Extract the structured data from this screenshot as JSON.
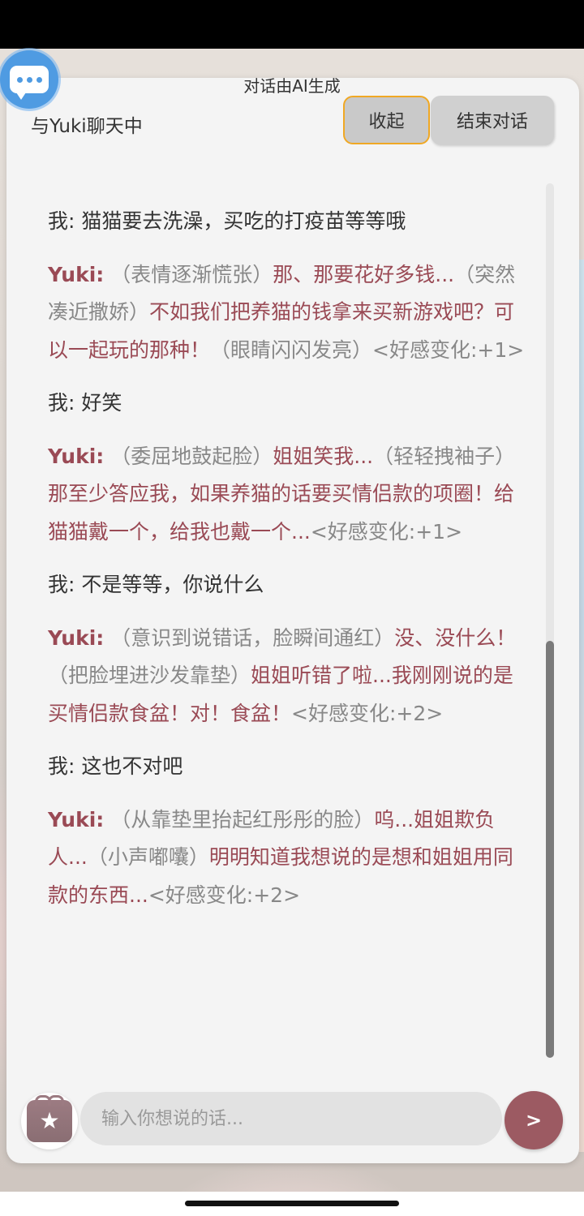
{
  "header": {
    "ai_disclaimer": "对话由AI生成",
    "chat_title": "与Yuki聊天中",
    "collapse_label": "收起",
    "end_label": "结束对话"
  },
  "conversation": [
    {
      "speaker": "我:",
      "segments": [
        {
          "type": "me-text",
          "text": "猫猫要去洗澡，买吃的打疫苗等等哦"
        }
      ]
    },
    {
      "speaker": "Yuki:",
      "segments": [
        {
          "type": "action",
          "text": "（表情逐渐慌张）"
        },
        {
          "type": "speech",
          "text": "那、那要花好多钱..."
        },
        {
          "type": "action",
          "text": "（突然凑近撒娇）"
        },
        {
          "type": "speech",
          "text": "不如我们把养猫的钱拿来买新游戏吧？可以一起玩的那种！"
        },
        {
          "type": "action",
          "text": "（眼睛闪闪发亮）"
        },
        {
          "type": "tag",
          "text": "<好感变化:+1>"
        }
      ]
    },
    {
      "speaker": "我:",
      "segments": [
        {
          "type": "me-text",
          "text": "好笑"
        }
      ]
    },
    {
      "speaker": "Yuki:",
      "segments": [
        {
          "type": "action",
          "text": "（委屈地鼓起脸）"
        },
        {
          "type": "speech",
          "text": "姐姐笑我..."
        },
        {
          "type": "action",
          "text": "（轻轻拽袖子）"
        },
        {
          "type": "speech",
          "text": "那至少答应我，如果养猫的话要买情侣款的项圈！给猫猫戴一个，给我也戴一个..."
        },
        {
          "type": "tag",
          "text": "<好感变化:+1>"
        }
      ]
    },
    {
      "speaker": "我:",
      "segments": [
        {
          "type": "me-text",
          "text": "不是等等，你说什么"
        }
      ]
    },
    {
      "speaker": "Yuki:",
      "segments": [
        {
          "type": "action",
          "text": "（意识到说错话，脸瞬间通红）"
        },
        {
          "type": "speech",
          "text": "没、没什么！"
        },
        {
          "type": "action",
          "text": "（把脸埋进沙发靠垫）"
        },
        {
          "type": "speech",
          "text": "姐姐听错了啦...我刚刚说的是买情侣款食盆！对！食盆！"
        },
        {
          "type": "tag",
          "text": "<好感变化:+2>"
        }
      ]
    },
    {
      "speaker": "我:",
      "segments": [
        {
          "type": "me-text",
          "text": "这也不对吧"
        }
      ]
    },
    {
      "speaker": "Yuki:",
      "segments": [
        {
          "type": "action",
          "text": "（从靠垫里抬起红彤彤的脸）"
        },
        {
          "type": "speech",
          "text": "呜...姐姐欺负人..."
        },
        {
          "type": "action",
          "text": "（小声嘟囔）"
        },
        {
          "type": "speech",
          "text": "明明知道我想说的是想和姐姐用同款的东西..."
        },
        {
          "type": "tag",
          "text": "<好感变化:+2>"
        }
      ]
    }
  ],
  "composer": {
    "placeholder": "输入你想说的话...",
    "send_label": ">"
  },
  "icons": {
    "chat_bubble": "chat-bubble-icon",
    "gift": "gift-icon",
    "star": "star-icon"
  },
  "colors": {
    "yuki_name": "#9a4a55",
    "speech": "#9a4a55",
    "action": "#888888",
    "send_button": "#9c5a62",
    "floating_button": "#4f9be2",
    "collapse_border": "#f0a824"
  }
}
